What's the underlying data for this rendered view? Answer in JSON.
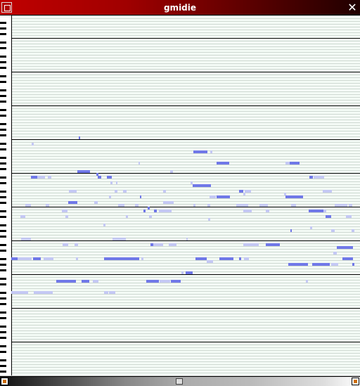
{
  "window": {
    "title": "gmidie"
  },
  "piano_roll": {
    "colors": {
      "background": "#f4fbf6",
      "staff_line": "#a9b8ad",
      "octave_line": "#000000",
      "note_light": "#c4c8f4",
      "note_dark": "#7078e8",
      "key_black": "#000000",
      "key_white": "#ffffff"
    }
  },
  "icons": {
    "menu": "window-menu-icon",
    "close": "close-icon",
    "scroll_left": "scroll-left-arrow-icon",
    "scroll_right": "scroll-right-arrow-icon"
  },
  "symbols": {
    "close": "✕"
  }
}
